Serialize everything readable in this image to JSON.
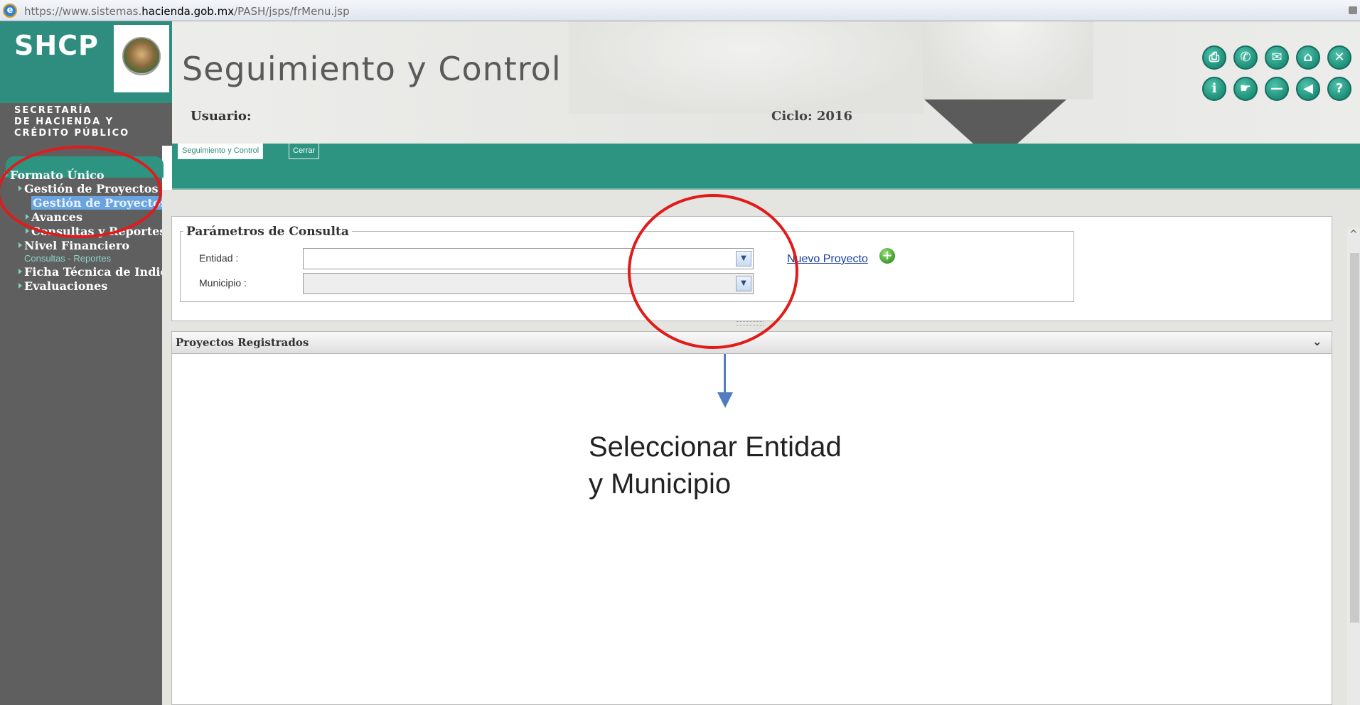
{
  "browser": {
    "url_prefix": "https://www.sistemas.",
    "url_domain": "hacienda.gob.mx",
    "url_path": "/PASH/jsps/frMenu.jsp"
  },
  "header": {
    "logo_text": "SHCP",
    "logo_subtitle_1": "SECRETARÍA",
    "logo_subtitle_2": "DE HACIENDA Y",
    "logo_subtitle_3": "CRÉDITO PÚBLICO",
    "title": "Seguimiento y Control",
    "usuario_label": "Usuario:",
    "ciclo_label": "Ciclo: 2016"
  },
  "toolbar": {
    "icons": [
      "print-icon",
      "phone-icon",
      "mail-icon",
      "home-icon",
      "close-icon",
      "info-icon",
      "pointer-icon",
      "minimize-icon",
      "back-icon",
      "help-icon"
    ],
    "glyphs": [
      "⎙",
      "✆",
      "✉",
      "⌂",
      "✕",
      "ℹ",
      "☛",
      "—",
      "◀",
      "?"
    ]
  },
  "tabs": [
    {
      "label": "Seguimiento y Control",
      "active": true
    },
    {
      "label": "Cerrar",
      "active": false
    }
  ],
  "sidebar": {
    "items": [
      {
        "label": "Formato Único"
      },
      {
        "label": "Gestión de Proyectos"
      },
      {
        "label": "Gestión de Proyectos"
      },
      {
        "label": "Avances"
      },
      {
        "label": "Consultas y Reportes"
      },
      {
        "label": "Nivel Financiero"
      },
      {
        "label": "Consultas - Reportes"
      },
      {
        "label": "Ficha Técnica de Indic"
      },
      {
        "label": "Evaluaciones"
      }
    ]
  },
  "query": {
    "legend": "Parámetros de Consulta",
    "entidad_label": "Entidad :",
    "entidad_value": "",
    "municipio_label": "Municipio :",
    "municipio_value": "",
    "nuevo_proyecto": "Nuevo Proyecto"
  },
  "grid": {
    "title": "Proyectos Registrados"
  },
  "annotation": {
    "line1": "Seleccionar Entidad",
    "line2": "y Municipio",
    "highlight_color": "#e11a1a",
    "arrow_color": "#4f7dc0"
  },
  "colors": {
    "brand_green": "#2e8d7e",
    "sidebar_gray": "#5f5f5f"
  }
}
